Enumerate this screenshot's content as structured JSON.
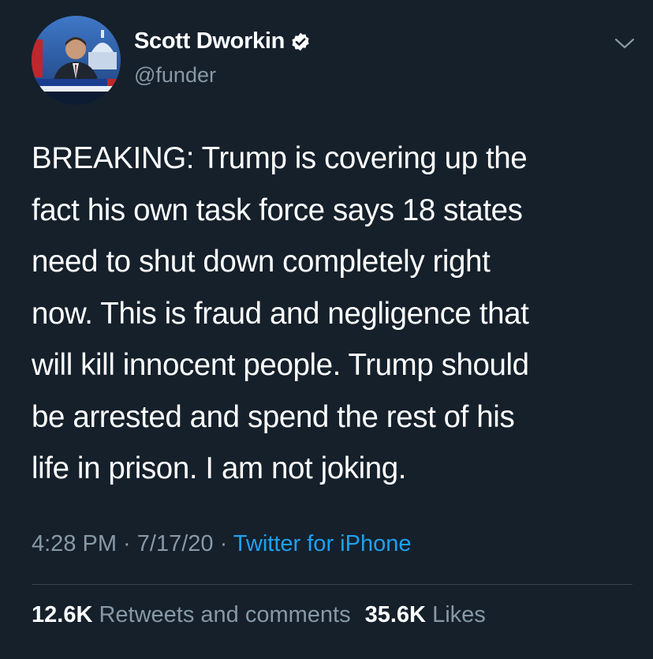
{
  "author": {
    "name": "Scott Dworkin",
    "handle": "@funder",
    "verified": true,
    "avatar_icon": "profile-photo-news-broadcast"
  },
  "tweet": {
    "lines": [
      "BREAKING: Trump is covering up the",
      "fact his own task force says 18 states",
      "need to shut down completely right",
      "now. This is fraud and negligence that",
      "will kill innocent people. Trump should",
      "be arrested and spend the rest of his",
      "life in prison. I am not joking."
    ]
  },
  "meta": {
    "time": "4:28 PM",
    "separator": " · ",
    "date": "7/17/20",
    "source": "Twitter for iPhone"
  },
  "stats": {
    "retweets_count": "12.6K",
    "retweets_label": "Retweets and comments",
    "likes_count": "35.6K",
    "likes_label": "Likes"
  },
  "colors": {
    "background": "#15202b",
    "secondary_text": "#8899a6",
    "accent": "#1da1f2",
    "divider": "#38444d"
  }
}
